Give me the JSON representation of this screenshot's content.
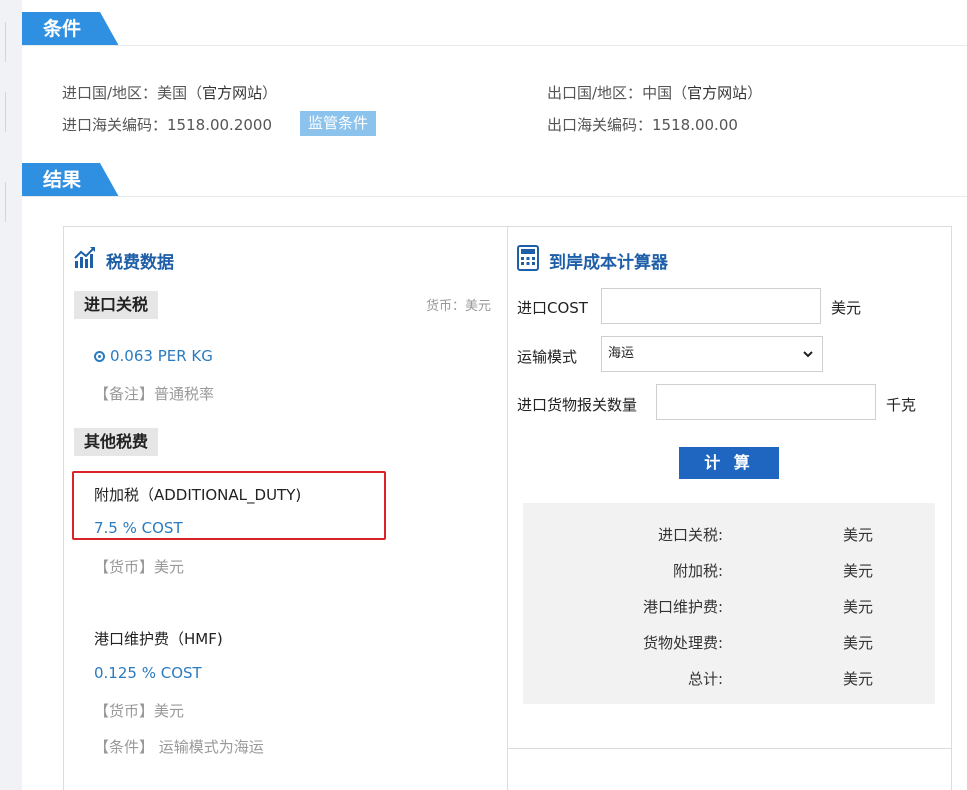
{
  "sections": {
    "conditions_title": "条件",
    "results_title": "结果"
  },
  "conditions": {
    "import_country_label": "进口国/地区：",
    "import_country_value": "美国（",
    "import_country_link": "官方网站",
    "import_country_close": "）",
    "import_hs_label": "进口海关编码：",
    "import_hs_value": "1518.00.2000",
    "regulatory_button": "监管条件",
    "export_country_label": "出口国/地区：",
    "export_country_value": "中国（",
    "export_country_link": "官方网站",
    "export_country_close": "）",
    "export_hs_label": "出口海关编码：",
    "export_hs_value": "1518.00.00"
  },
  "tax_panel": {
    "title": "税费数据",
    "import_duty_title": "进口关税",
    "currency_note": "货币：美元",
    "duty_rate": "0.063 PER KG",
    "duty_note": "【备注】普通税率",
    "other_fees_title": "其他税费",
    "additional_duty_name": "附加税（ADDITIONAL_DUTY)",
    "additional_duty_rate": "7.5 % COST",
    "additional_duty_currency": "【货币】美元",
    "hmf_name": "港口维护费（HMF)",
    "hmf_rate": "0.125 % COST",
    "hmf_currency": "【货币】美元",
    "hmf_condition": "【条件】 运输模式为海运"
  },
  "calculator": {
    "title": "到岸成本计算器",
    "import_cost_label": "进口COST",
    "import_cost_unit": "美元",
    "import_cost_value": "",
    "transport_label": "运输模式",
    "transport_selected": "海运",
    "quantity_label": "进口货物报关数量",
    "quantity_unit": "千克",
    "quantity_value": "",
    "calculate_button": "计 算"
  },
  "summary": {
    "rows": [
      {
        "label": "进口关税:",
        "unit": "美元"
      },
      {
        "label": "附加税:",
        "unit": "美元"
      },
      {
        "label": "港口维护费:",
        "unit": "美元"
      },
      {
        "label": "货物处理费:",
        "unit": "美元"
      },
      {
        "label": "总计:",
        "unit": "美元"
      }
    ]
  },
  "colors": {
    "accent": "#2f8fe0",
    "title_blue": "#1e5fa8",
    "link_blue": "#2a7bc0",
    "button_blue": "#1f66c1",
    "highlight_red": "#d9232a"
  }
}
